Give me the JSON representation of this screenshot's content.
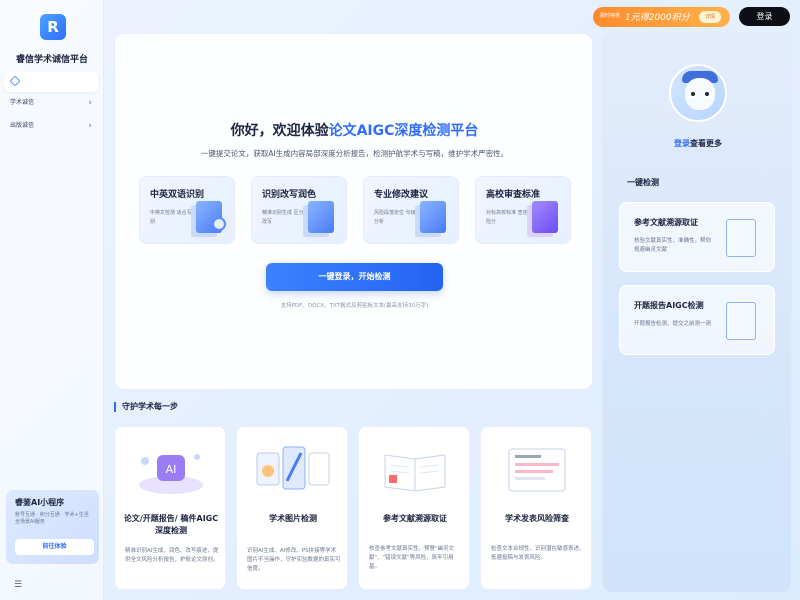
{
  "sidebar": {
    "brand": "睿信学术诚信平台",
    "items": [
      {
        "label": "学术诚信"
      },
      {
        "label": "出版诚信"
      }
    ],
    "promo": {
      "title": "睿鉴AI小程序",
      "desc": "账号互通 · 积分互通 · 学术+生活全场景AI服务",
      "button": "前往体验"
    }
  },
  "topbar": {
    "promo_tag": "限时特惠",
    "promo_text": "1元得2000积分",
    "promo_detail": "详情",
    "login": "登录"
  },
  "hero": {
    "title_prefix": "你好，欢迎体验",
    "title_highlight": "论文AIGC深度检测平台",
    "subtitle": "一键提交论文，获取AI生成内容局部深度分析报告，检测护航学术与写稿，维护学术严密性。",
    "features": [
      {
        "title": "中英双语识别",
        "desc": "中英文检测 适合写作识别"
      },
      {
        "title": "识别改写润色",
        "desc": "精准识别生成 区分润色改写"
      },
      {
        "title": "专业修改建议",
        "desc": "风险段落定位 句级深度分析"
      },
      {
        "title": "高校审查标准",
        "desc": "对标高校标准 查定义风险分"
      }
    ],
    "cta": "一键登录，开始检测",
    "hint": "支持PDF、DOCX、TXT格式及剪贴板文本(最高支持30万字)"
  },
  "section": {
    "title": "守护学术每一步",
    "cards": [
      {
        "title": "论文/开题报告/ 稿件AIGC深度检测",
        "desc": "精准识别AI生成、润色、改写痕迹，提供全文风险分析报告，护航论文原创。"
      },
      {
        "title": "学术图片检测",
        "desc": "识别AI生成、AI修改、PS拼接等学术图片不当操作，守护实验数据的真实可信度。"
      },
      {
        "title": "参考文献溯源取证",
        "desc": "核查参考文献真实性，预警\"幽灵文献\"、\"错误文献\"等风险，筑牢引用基。"
      },
      {
        "title": "学术发表风险筛查",
        "desc": "检查文本合规性，识别潜在敏感表述、抵避投稿与发表风险。"
      }
    ]
  },
  "right": {
    "login_link": "登录",
    "login_suffix": "查看更多",
    "section_title": "一键检测",
    "cards": [
      {
        "title": "参考文献溯源取证",
        "desc": "核验文献真实性、准确性，帮你规避幽灵文献"
      },
      {
        "title": "开题报告AIGC检测",
        "desc": "开题报告检测、提交之前测一测"
      }
    ]
  }
}
